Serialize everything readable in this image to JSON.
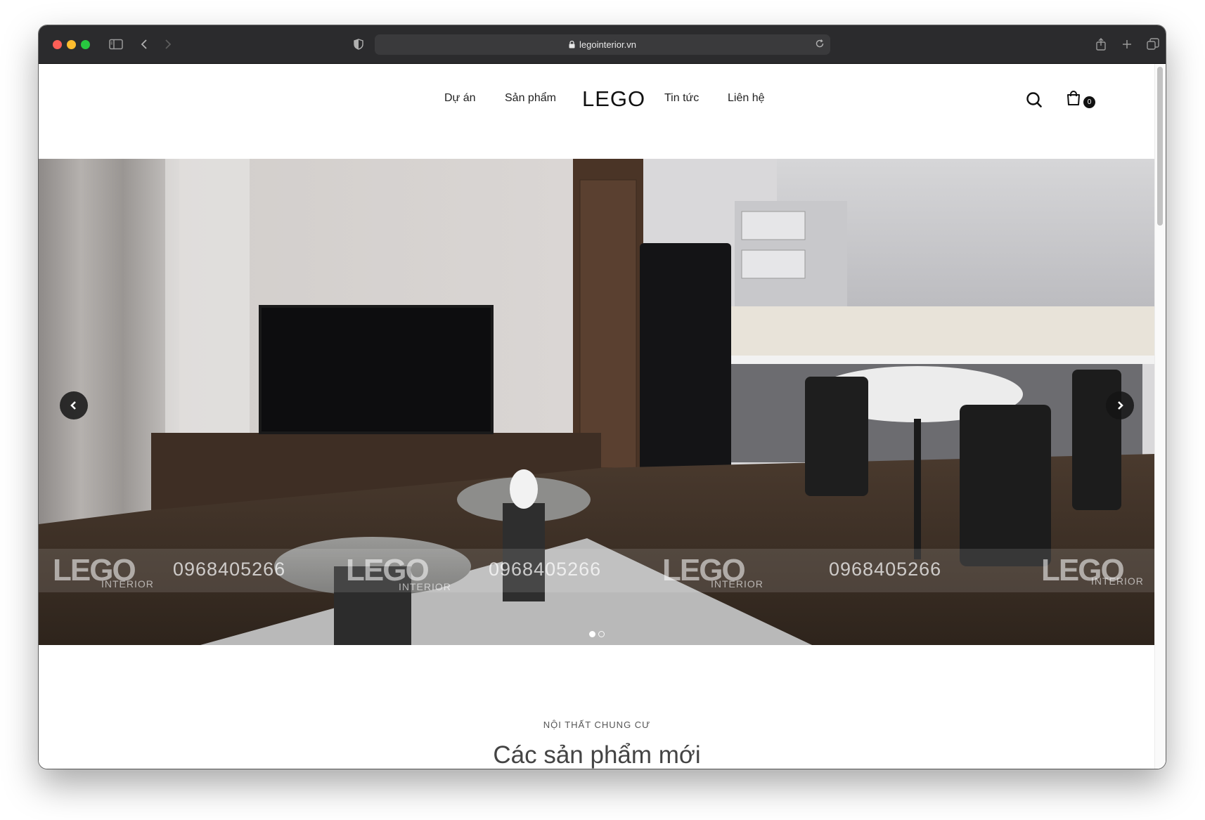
{
  "browser": {
    "url": "legointerior.vn"
  },
  "nav": {
    "items": [
      "Dự án",
      "Sản phẩm",
      "Tin tức",
      "Liên hệ"
    ],
    "logo": "LEGO",
    "cart_count": "0"
  },
  "hero": {
    "watermark": {
      "brand": "LEGO",
      "sub": "INTERIOR",
      "phone": "0968405266"
    },
    "slides_total": 2,
    "active_slide": 1
  },
  "section": {
    "kicker": "NỘI THẤT CHUNG CƯ",
    "title": "Các sản phẩm mới"
  },
  "colors": {
    "titlebar": "#2b2b2d",
    "urlbar": "#3a3a3c",
    "text": "#222222"
  }
}
